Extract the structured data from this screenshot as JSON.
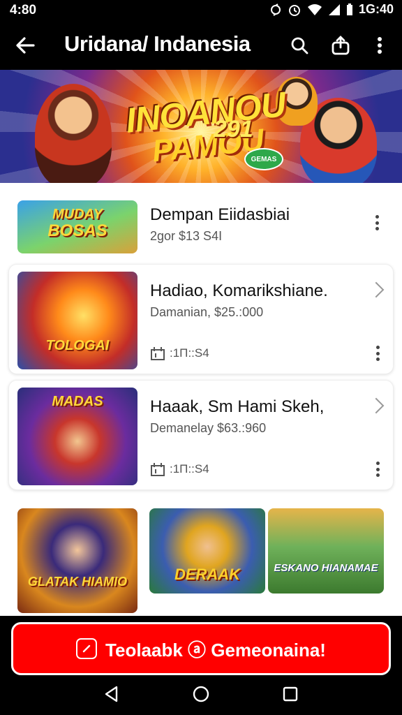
{
  "status_bar": {
    "time": "4:80",
    "right_time": "1G:40",
    "icons": [
      "sync-icon",
      "alarm-icon",
      "wifi-icon",
      "signal-icon",
      "battery-icon"
    ]
  },
  "app_bar": {
    "title": "Uridana/ Indanesia",
    "icons": [
      "back-arrow-icon",
      "search-icon",
      "share-icon",
      "more-vertical-icon"
    ]
  },
  "banner": {
    "logo_line1": "INOANOU",
    "logo_line2": "PAMOU",
    "number": "291",
    "tag": "GEMAS"
  },
  "items": [
    {
      "title": "Dempan Eiidasbiai",
      "subtitle": "2gor $13 S4I",
      "thumb_caption": "BOSAS",
      "thumb_caption_top": "MUDAY",
      "action": "kebab"
    },
    {
      "title": "Hadiao, Komarikshiane.",
      "subtitle": "Damanian, $25.:000",
      "meta": ":1Π::S4",
      "thumb_caption": "TOLOGAI",
      "thumb_caption_top": "",
      "action": "chevron"
    },
    {
      "title": "Haaak, Sm Hami Skeh,",
      "subtitle": "Demanelay $63.:960",
      "meta": ":1Π::S4",
      "thumb_caption": "MADAS",
      "thumb_caption_top": "",
      "action": "chevron"
    }
  ],
  "grid": [
    {
      "caption": "GLATAK HIAMIO"
    },
    {
      "caption": "DERAAK"
    },
    {
      "caption": "ESKANO HIANAMAE"
    }
  ],
  "cta": {
    "label": "Teolaabk ⓐ Gemeonaina!"
  },
  "system_nav": [
    "back-nav-icon",
    "home-nav-icon",
    "recents-nav-icon"
  ],
  "colors": {
    "cta_red": "#ff0000",
    "app_bar_bg": "#000000",
    "content_bg": "#ffffff"
  }
}
